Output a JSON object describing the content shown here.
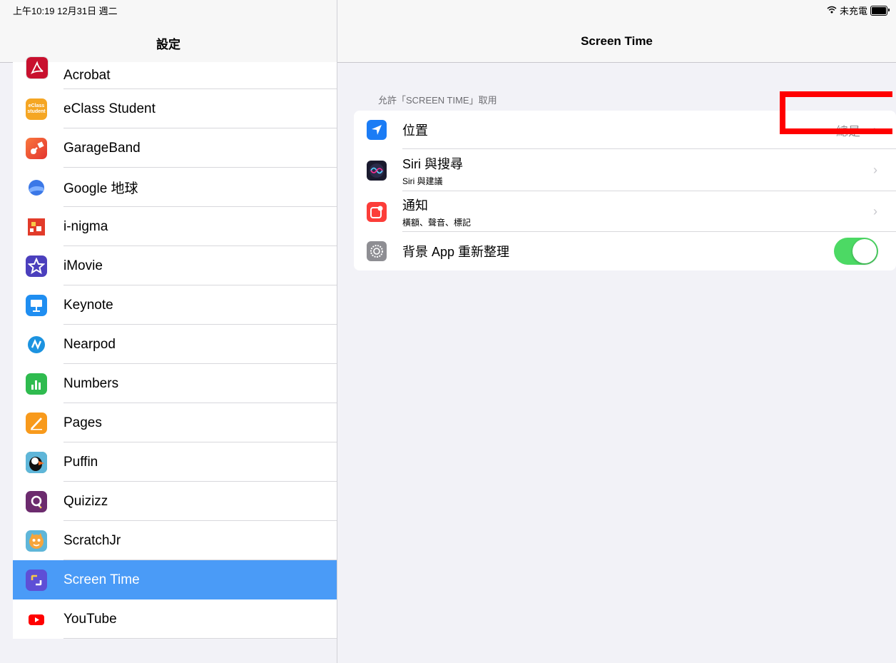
{
  "status_bar": {
    "time_date": "上午10:19  12月31日 週二",
    "charging": "未充電",
    "wifi_icon": "wifi-icon",
    "battery_icon": "battery-icon"
  },
  "sidebar": {
    "title": "設定",
    "items": [
      {
        "label": "Acrobat",
        "icon": "acrobat-icon",
        "color": "#c8102e"
      },
      {
        "label": "eClass Student",
        "icon": "eclass-icon",
        "color": "#f5a623",
        "icon_text": "eClass student"
      },
      {
        "label": "GarageBand",
        "icon": "garageband-icon",
        "color": "#ef5a3a"
      },
      {
        "label": "Google 地球",
        "icon": "google-earth-icon",
        "color": "#3b78e7"
      },
      {
        "label": "i-nigma",
        "icon": "inigma-icon",
        "color": "#e23b2a"
      },
      {
        "label": "iMovie",
        "icon": "imovie-icon",
        "color": "#4b3fbd"
      },
      {
        "label": "Keynote",
        "icon": "keynote-icon",
        "color": "#1f8ef1"
      },
      {
        "label": "Nearpod",
        "icon": "nearpod-icon",
        "color": "#1c93e0"
      },
      {
        "label": "Numbers",
        "icon": "numbers-icon",
        "color": "#2fbb4f"
      },
      {
        "label": "Pages",
        "icon": "pages-icon",
        "color": "#f89a1c"
      },
      {
        "label": "Puffin",
        "icon": "puffin-icon",
        "color": "#2a9d5c"
      },
      {
        "label": "Quizizz",
        "icon": "quizizz-icon",
        "color": "#6c2b6e"
      },
      {
        "label": "ScratchJr",
        "icon": "scratchjr-icon",
        "color": "#f7a53b"
      },
      {
        "label": "Screen Time",
        "icon": "screen-time-icon",
        "color": "#5e4fd6",
        "selected": true
      },
      {
        "label": "YouTube",
        "icon": "youtube-icon",
        "color": "#ff0000"
      }
    ]
  },
  "detail": {
    "title": "Screen Time",
    "section_header": "允許「SCREEN TIME」取用",
    "rows": [
      {
        "title": "位置",
        "subtitle": "",
        "value": "總是",
        "icon": "location-arrow-icon",
        "color": "#1b7cf5"
      },
      {
        "title": "Siri 與搜尋",
        "subtitle": "Siri 與建議",
        "value": "",
        "icon": "siri-icon",
        "color": "#1a1a2e"
      },
      {
        "title": "通知",
        "subtitle": "橫額、聲音、標記",
        "value": "",
        "icon": "notifications-icon",
        "color": "#fc3d39"
      },
      {
        "title": "背景 App 重新整理",
        "subtitle": "",
        "value": "",
        "icon": "gear-icon",
        "color": "#8e8e93",
        "toggle_on": true
      }
    ]
  },
  "colors": {
    "selected_bg": "#4a9bf7",
    "toggle_on": "#4cd964",
    "highlight": "#ff0000"
  }
}
